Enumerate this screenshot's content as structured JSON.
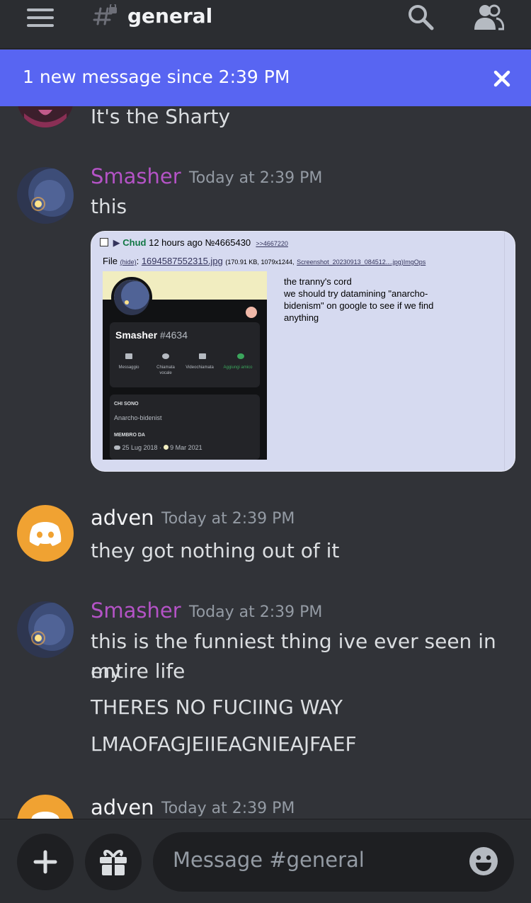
{
  "header": {
    "channel_name": "general",
    "icons": [
      "menu-icon",
      "locked-channel-hash-icon",
      "search-icon",
      "members-icon"
    ]
  },
  "banner": {
    "text": "1 new message since 2:39 PM",
    "icon": "close-icon",
    "color": "#5865f2"
  },
  "messages": [
    {
      "text": "It's the Sharty"
    },
    {
      "author": "Smasher",
      "author_color": "#b453c6",
      "time": "Today at 2:39 PM",
      "text": "this",
      "embed": {
        "poster_name": "Chud",
        "post_meta": "12 hours ago №4665430",
        "reply_link": ">>4667220",
        "file_label": "File",
        "hide_link": "(hide)",
        "file_name": "1694587552315.jpg",
        "file_info": "(170.91 KB, 1079x1244,",
        "file_source_link": "Screenshot_20230913_084512....jpg",
        "imgops_link": ")ImgOps",
        "body_lines": [
          "the tranny's cord",
          "we should try datamining \"anarcho-bidenism\" on google to see if we find anything"
        ],
        "thumbnail": {
          "username": "Smasher",
          "discriminator": "#4634",
          "actions": [
            "Messaggio",
            "Chiamata vocale",
            "Videochiamata",
            "Aggiungi amico"
          ],
          "section_about": "CHI SONO",
          "about_text": "Anarcho-bidenist",
          "section_member": "MEMBRO DA",
          "date_discord": "25 Lug 2018",
          "date_server": "9 Mar 2021"
        }
      }
    },
    {
      "author": "adven",
      "author_color": "#f2f3f5",
      "time": "Today at 2:39 PM",
      "text": "they got nothing out of it"
    },
    {
      "author": "Smasher",
      "author_color": "#b453c6",
      "time": "Today at 2:39 PM",
      "lines": [
        "this is the funniest thing ive ever seen in my",
        "entire life",
        "THERES NO FUCIING WAY",
        "LMAOFAGJEIIEAGNIEAJFAEF"
      ]
    },
    {
      "author": "adven",
      "author_color": "#f2f3f5",
      "time": "Today at 2:39 PM"
    }
  ],
  "composer": {
    "placeholder": "Message #general",
    "icons": [
      "plus-icon",
      "gift-icon",
      "emoji-icon"
    ]
  }
}
